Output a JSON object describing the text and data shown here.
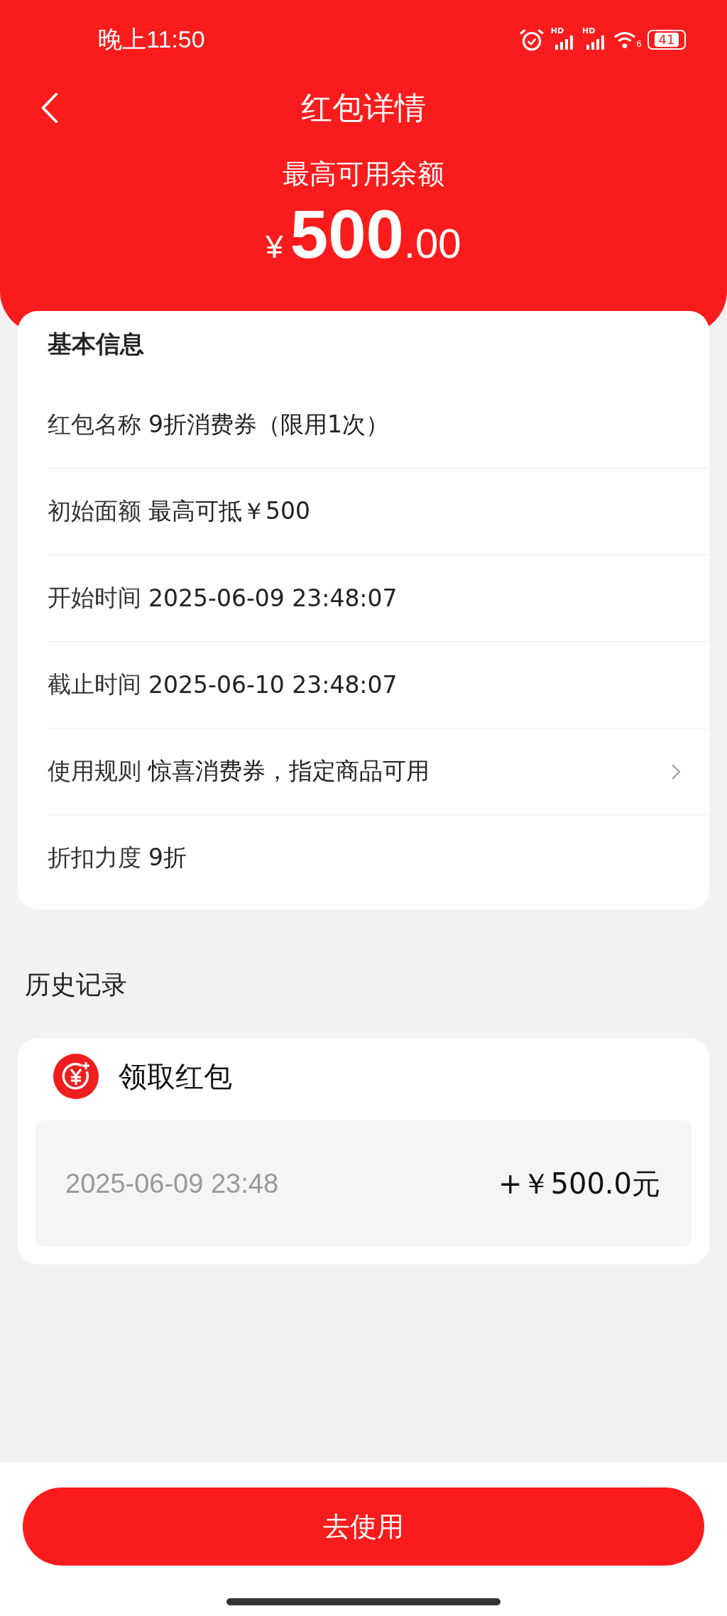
{
  "status_bar": {
    "time": "晚上11:50",
    "signals": [
      {
        "label": "HD"
      },
      {
        "label": "HD"
      }
    ],
    "wifi_label": "6",
    "battery": "41"
  },
  "nav": {
    "title": "红包详情"
  },
  "balance": {
    "label": "最高可用余额",
    "currency": "¥",
    "integer": "500",
    "decimal": ".00"
  },
  "info": {
    "title": "基本信息",
    "rows": [
      {
        "label": "红包名称",
        "value": "9折消费券（限用1次）",
        "chevron": false
      },
      {
        "label": "初始面额",
        "value": "最高可抵￥500",
        "chevron": false
      },
      {
        "label": "开始时间",
        "value": "2025-06-09 23:48:07",
        "chevron": false
      },
      {
        "label": "截止时间",
        "value": "2025-06-10 23:48:07",
        "chevron": false
      },
      {
        "label": "使用规则",
        "value": "惊喜消费券，指定商品可用",
        "chevron": true
      },
      {
        "label": "折扣力度",
        "value": "9折",
        "chevron": false
      }
    ]
  },
  "history": {
    "title": "历史记录",
    "records": [
      {
        "title": "领取红包",
        "time": "2025-06-09 23:48",
        "amount": "+￥500.0元"
      }
    ]
  },
  "action": {
    "label": "去使用"
  }
}
